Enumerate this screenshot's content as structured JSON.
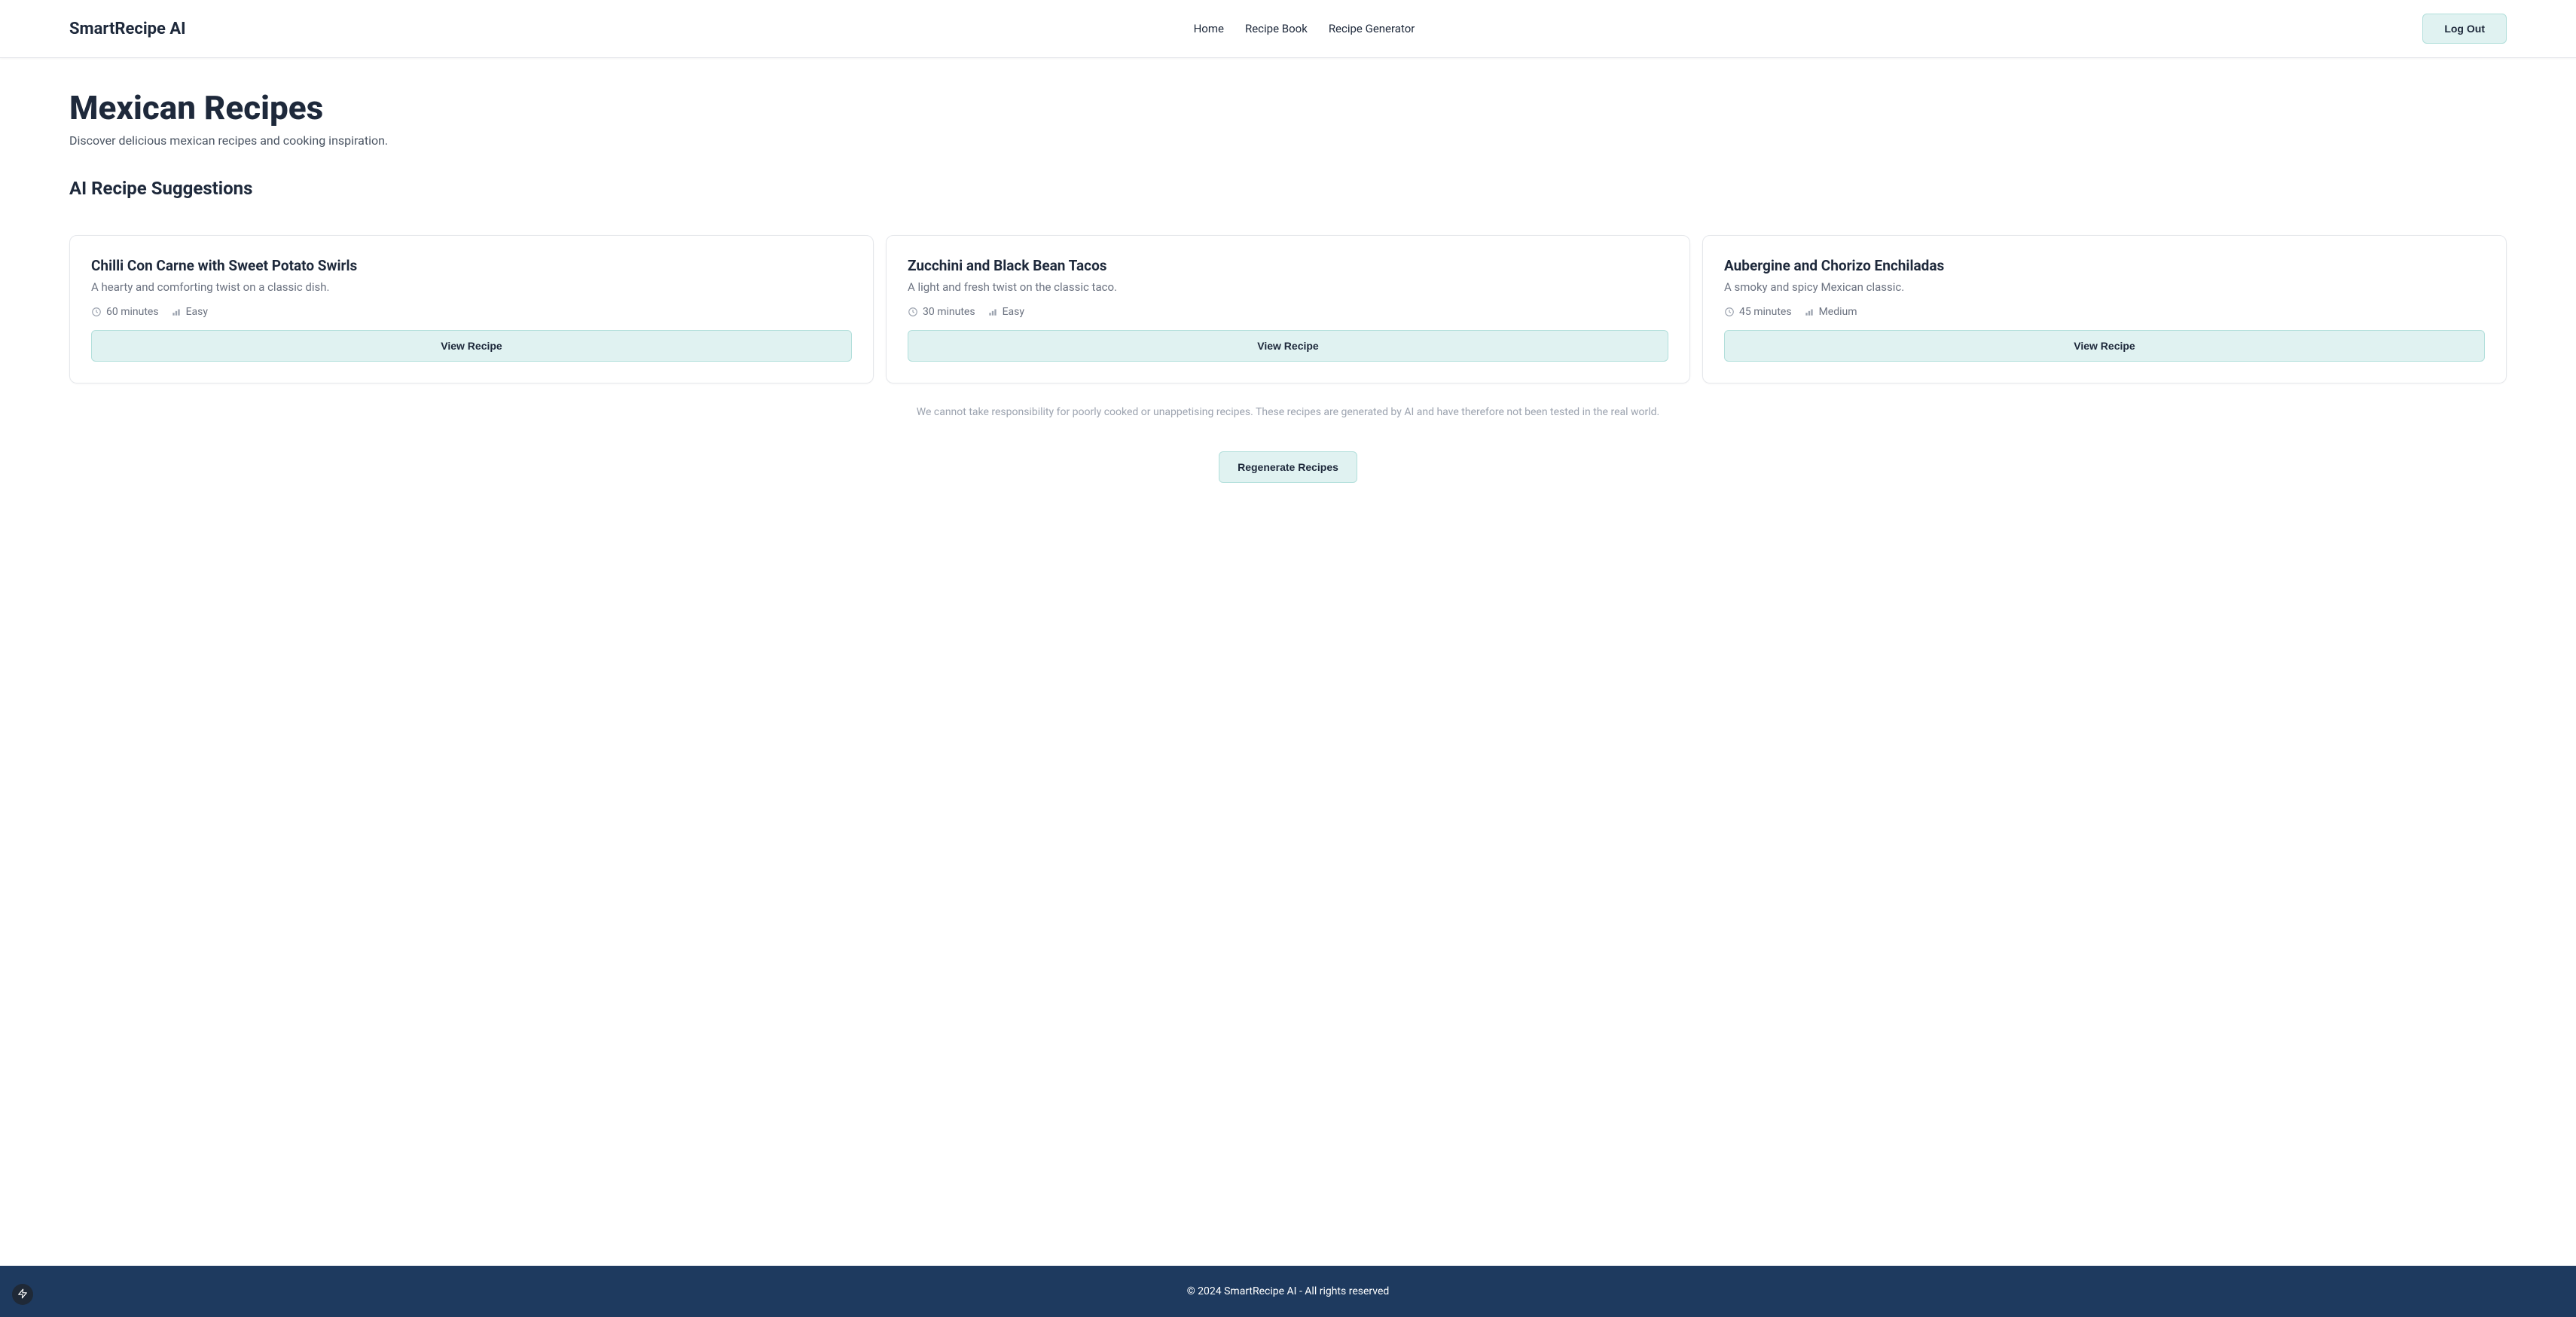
{
  "header": {
    "logo": "SmartRecipe AI",
    "nav": {
      "home": "Home",
      "recipe_book": "Recipe Book",
      "recipe_generator": "Recipe Generator"
    },
    "logout": "Log Out"
  },
  "page": {
    "title": "Mexican Recipes",
    "subtitle": "Discover delicious mexican recipes and cooking inspiration.",
    "section_title": "AI Recipe Suggestions"
  },
  "recipes": [
    {
      "title": "Chilli Con Carne with Sweet Potato Swirls",
      "description": "A hearty and comforting twist on a classic dish.",
      "time": "60 minutes",
      "difficulty": "Easy",
      "view_label": "View Recipe"
    },
    {
      "title": "Zucchini and Black Bean Tacos",
      "description": "A light and fresh twist on the classic taco.",
      "time": "30 minutes",
      "difficulty": "Easy",
      "view_label": "View Recipe"
    },
    {
      "title": "Aubergine and Chorizo Enchiladas",
      "description": "A smoky and spicy Mexican classic.",
      "time": "45 minutes",
      "difficulty": "Medium",
      "view_label": "View Recipe"
    }
  ],
  "disclaimer": "We cannot take responsibility for poorly cooked or unappetising recipes. These recipes are generated by AI and have therefore not been tested in the real world.",
  "regenerate_label": "Regenerate Recipes",
  "footer": {
    "text": "© 2024 SmartRecipe AI - All rights reserved"
  }
}
